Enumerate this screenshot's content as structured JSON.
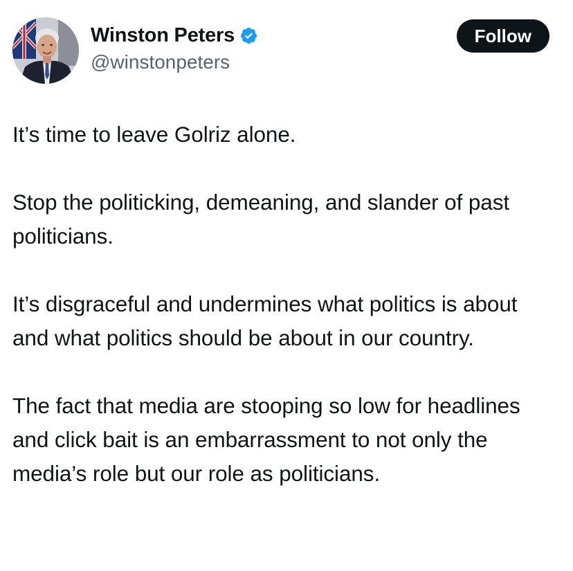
{
  "author": {
    "display_name": "Winston Peters",
    "handle": "@winstonpeters",
    "verified": true,
    "avatar_icon": "profile-photo"
  },
  "actions": {
    "follow_label": "Follow"
  },
  "tweet": {
    "paragraphs": [
      "It’s time to leave Golriz alone.",
      "Stop the politicking, demeaning, and slander of past politicians.",
      "It’s disgraceful and undermines what politics is about and what politics should be about in our country.",
      "The fact that media are stooping so low for headlines and click bait is an embarrassment to not only the media’s role but our role as politicians."
    ]
  },
  "colors": {
    "text": "#0f1419",
    "secondary_text": "#536471",
    "verified_badge": "#1d9bf0",
    "follow_button_bg": "#0f1419",
    "follow_button_text": "#ffffff"
  }
}
